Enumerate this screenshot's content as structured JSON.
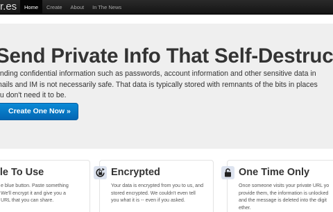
{
  "nav": {
    "brand": "r.es",
    "items": [
      "Home",
      "Create",
      "About",
      "In The News"
    ],
    "active_index": 0
  },
  "hero": {
    "title": "Send Private Info That Self-Destructs",
    "lines": [
      "ending confidential information such as passwords, account information and other sensitive data in",
      "mails and IM is not necessarily safe. That data is typically stored with remnants of the bits in places",
      "ou don't need it to be."
    ],
    "cta_label": "Create One Now »"
  },
  "features": [
    {
      "title": "ple To Use",
      "icon": "",
      "lines": [
        "e blue button. Paste something",
        "We'll encrypt it and give you a",
        "URL that you can share."
      ]
    },
    {
      "title": "Encrypted",
      "icon": "refresh-lock-icon",
      "lines": [
        "Your data is encrypted from you to us, and",
        "stored encrypted. We couldn't even tell",
        "you what it is -- even if you asked."
      ]
    },
    {
      "title": "One Time Only",
      "icon": "lock-icon",
      "lines": [
        "Once someone visits your private URL yo",
        "provide them, the information is unlocked",
        "and the message is deleted into the digit",
        "ether."
      ]
    }
  ],
  "colors": {
    "navbar": "#1c1c1c",
    "hero_bg": "#efefef",
    "cta": "#0a7cc8"
  }
}
